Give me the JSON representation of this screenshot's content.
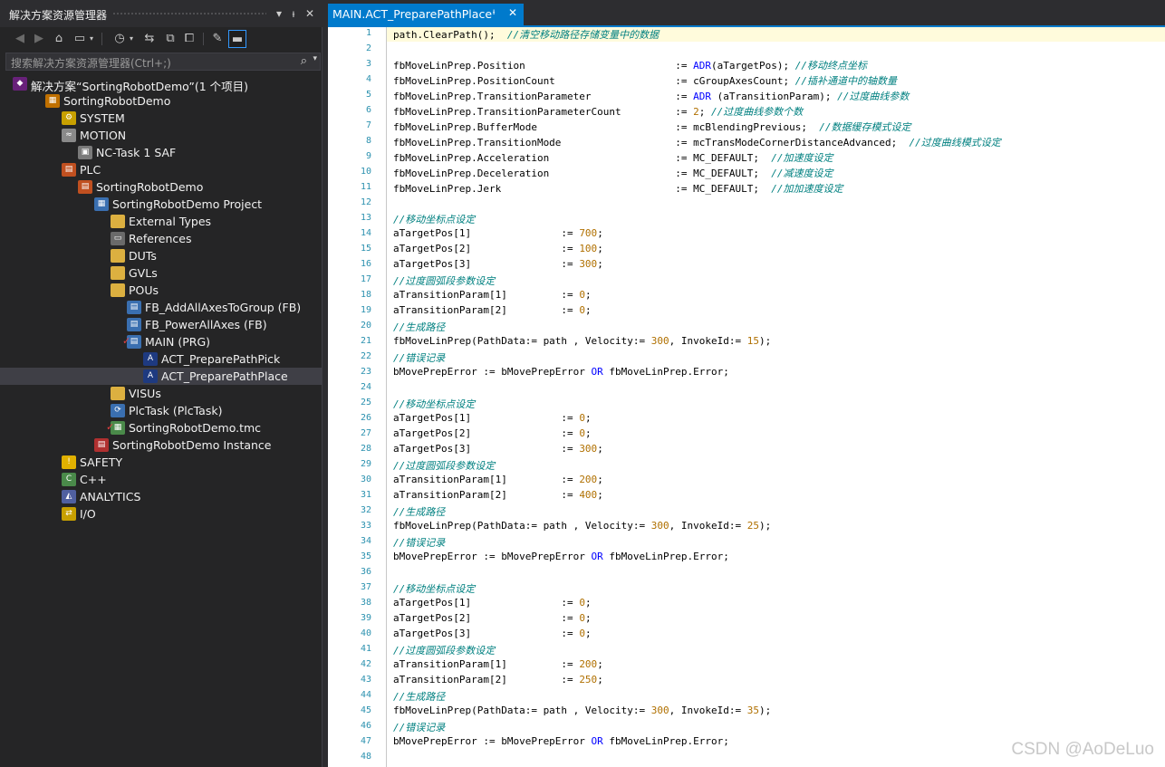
{
  "explorer": {
    "title": "解决方案资源管理器",
    "search_placeholder": "搜索解决方案资源管理器(Ctrl+;)",
    "pin_glyph": "ᵼ",
    "close_glyph": "✕",
    "dropdown_glyph": "▾"
  },
  "tree": [
    {
      "label": "解决方案“SortingRobotDemo”(1 个项目)",
      "depth": 0,
      "arrow": "",
      "icon": "solution-icon",
      "color": "#68217a",
      "glyph": "◆",
      "check": false
    },
    {
      "label": "SortingRobotDemo",
      "depth": 1,
      "arrow": "◢",
      "icon": "project-icon",
      "color": "#c07000",
      "glyph": "▦",
      "check": false
    },
    {
      "label": "SYSTEM",
      "depth": 2,
      "arrow": "▷",
      "icon": "system-icon",
      "color": "#c8a000",
      "glyph": "⚙",
      "check": false
    },
    {
      "label": "MOTION",
      "depth": 2,
      "arrow": "◢",
      "icon": "motion-icon",
      "color": "#8a8a8a",
      "glyph": "≈",
      "check": false
    },
    {
      "label": "NC-Task 1 SAF",
      "depth": 3,
      "arrow": "▷",
      "icon": "nc-task-icon",
      "color": "#7a7a7a",
      "glyph": "▣",
      "check": false
    },
    {
      "label": "PLC",
      "depth": 2,
      "arrow": "◢",
      "icon": "plc-icon",
      "color": "#c05020",
      "glyph": "▤",
      "check": false
    },
    {
      "label": "SortingRobotDemo",
      "depth": 3,
      "arrow": "◢",
      "icon": "plc-project-icon",
      "color": "#c05020",
      "glyph": "▤",
      "check": false
    },
    {
      "label": "SortingRobotDemo Project",
      "depth": 4,
      "arrow": "◢",
      "icon": "plc-subproject-icon",
      "color": "#3a6fb0",
      "glyph": "▦",
      "check": false
    },
    {
      "label": "External Types",
      "depth": 5,
      "arrow": "▷",
      "icon": "folder-icon",
      "color": "#dcb040",
      "glyph": "",
      "check": false
    },
    {
      "label": "References",
      "depth": 5,
      "arrow": "▷",
      "icon": "references-icon",
      "color": "#6a6a6a",
      "glyph": "▭",
      "check": false
    },
    {
      "label": "DUTs",
      "depth": 5,
      "arrow": "",
      "icon": "folder-icon",
      "color": "#dcb040",
      "glyph": "",
      "check": false
    },
    {
      "label": "GVLs",
      "depth": 5,
      "arrow": "▷",
      "icon": "folder-icon",
      "color": "#dcb040",
      "glyph": "",
      "check": false
    },
    {
      "label": "POUs",
      "depth": 5,
      "arrow": "◢",
      "icon": "folder-open-icon",
      "color": "#dcb040",
      "glyph": "",
      "check": false
    },
    {
      "label": "FB_AddAllAxesToGroup (FB)",
      "depth": 6,
      "arrow": "",
      "icon": "function-block-icon",
      "color": "#3a6fb0",
      "glyph": "▤",
      "check": false
    },
    {
      "label": "FB_PowerAllAxes (FB)",
      "depth": 6,
      "arrow": "",
      "icon": "function-block-icon",
      "color": "#3a6fb0",
      "glyph": "▤",
      "check": false
    },
    {
      "label": "MAIN (PRG)",
      "depth": 6,
      "arrow": "◢",
      "icon": "program-icon",
      "color": "#3a6fb0",
      "glyph": "▤",
      "check": true
    },
    {
      "label": "ACT_PreparePathPick",
      "depth": 7,
      "arrow": "",
      "icon": "action-icon",
      "color": "#1e3a80",
      "glyph": "A",
      "check": false
    },
    {
      "label": "ACT_PreparePathPlace",
      "depth": 7,
      "arrow": "",
      "icon": "action-icon",
      "color": "#1e3a80",
      "glyph": "A",
      "check": false,
      "selected": true
    },
    {
      "label": "VISUs",
      "depth": 5,
      "arrow": "",
      "icon": "folder-icon",
      "color": "#dcb040",
      "glyph": "",
      "check": false
    },
    {
      "label": "PlcTask (PlcTask)",
      "depth": 5,
      "arrow": "▷",
      "icon": "task-icon",
      "color": "#3a6fb0",
      "glyph": "⟳",
      "check": false
    },
    {
      "label": "SortingRobotDemo.tmc",
      "depth": 5,
      "arrow": "",
      "icon": "tmc-file-icon",
      "color": "#4a8a4a",
      "glyph": "▦",
      "check": true
    },
    {
      "label": "SortingRobotDemo Instance",
      "depth": 4,
      "arrow": "▷",
      "icon": "instance-icon",
      "color": "#b03030",
      "glyph": "▤",
      "check": false
    },
    {
      "label": "SAFETY",
      "depth": 2,
      "arrow": "",
      "icon": "safety-icon",
      "color": "#e0b000",
      "glyph": "!",
      "check": false
    },
    {
      "label": "C++",
      "depth": 2,
      "arrow": "",
      "icon": "cpp-icon",
      "color": "#4a8a4a",
      "glyph": "C",
      "check": false
    },
    {
      "label": "ANALYTICS",
      "depth": 2,
      "arrow": "",
      "icon": "analytics-icon",
      "color": "#5060a0",
      "glyph": "◭",
      "check": false
    },
    {
      "label": "I/O",
      "depth": 2,
      "arrow": "▷",
      "icon": "io-icon",
      "color": "#c8a000",
      "glyph": "⇄",
      "check": false
    }
  ],
  "editor": {
    "tab_label": "MAIN.ACT_PreparePathPlace",
    "tab_pin": "ᵼ",
    "tab_close": "✕"
  },
  "code_lines": [
    {
      "n": "1",
      "parts": [
        [
          "t",
          "path.ClearPath();  "
        ],
        [
          "c",
          "//清空移动路径存储变量中的数据"
        ]
      ]
    },
    {
      "n": "2",
      "parts": []
    },
    {
      "n": "3",
      "parts": [
        [
          "t",
          "fbMoveLinPrep.Position                         := "
        ],
        [
          "k",
          "ADR"
        ],
        [
          "t",
          "(aTargetPos); "
        ],
        [
          "c",
          "//移动终点坐标"
        ]
      ]
    },
    {
      "n": "4",
      "parts": [
        [
          "t",
          "fbMoveLinPrep.PositionCount                    := cGroupAxesCount; "
        ],
        [
          "c",
          "//插补通道中的轴数量"
        ]
      ]
    },
    {
      "n": "5",
      "parts": [
        [
          "t",
          "fbMoveLinPrep.TransitionParameter              := "
        ],
        [
          "k",
          "ADR"
        ],
        [
          "t",
          " (aTransitionParam); "
        ],
        [
          "c",
          "//过度曲线参数"
        ]
      ]
    },
    {
      "n": "6",
      "parts": [
        [
          "t",
          "fbMoveLinPrep.TransitionParameterCount         := "
        ],
        [
          "n",
          "2"
        ],
        [
          "t",
          "; "
        ],
        [
          "c",
          "//过度曲线参数个数"
        ]
      ]
    },
    {
      "n": "7",
      "parts": [
        [
          "t",
          "fbMoveLinPrep.BufferMode                       := mcBlendingPrevious;  "
        ],
        [
          "c",
          "//数据缓存模式设定"
        ]
      ]
    },
    {
      "n": "8",
      "parts": [
        [
          "t",
          "fbMoveLinPrep.TransitionMode                   := mcTransModeCornerDistanceAdvanced;  "
        ],
        [
          "c",
          "//过度曲线模式设定"
        ]
      ]
    },
    {
      "n": "9",
      "parts": [
        [
          "t",
          "fbMoveLinPrep.Acceleration                     := MC_DEFAULT;  "
        ],
        [
          "c",
          "//加速度设定"
        ]
      ]
    },
    {
      "n": "10",
      "parts": [
        [
          "t",
          "fbMoveLinPrep.Deceleration                     := MC_DEFAULT;  "
        ],
        [
          "c",
          "//减速度设定"
        ]
      ]
    },
    {
      "n": "11",
      "parts": [
        [
          "t",
          "fbMoveLinPrep.Jerk                             := MC_DEFAULT;  "
        ],
        [
          "c",
          "//加加速度设定"
        ]
      ]
    },
    {
      "n": "12",
      "parts": []
    },
    {
      "n": "13",
      "parts": [
        [
          "c",
          "//移动坐标点设定"
        ]
      ]
    },
    {
      "n": "14",
      "parts": [
        [
          "t",
          "aTargetPos[1]               := "
        ],
        [
          "n",
          "700"
        ],
        [
          "t",
          ";"
        ]
      ]
    },
    {
      "n": "15",
      "parts": [
        [
          "t",
          "aTargetPos[2]               := "
        ],
        [
          "n",
          "100"
        ],
        [
          "t",
          ";"
        ]
      ]
    },
    {
      "n": "16",
      "parts": [
        [
          "t",
          "aTargetPos[3]               := "
        ],
        [
          "n",
          "300"
        ],
        [
          "t",
          ";"
        ]
      ]
    },
    {
      "n": "17",
      "parts": [
        [
          "c",
          "//过度圆弧段参数设定"
        ]
      ]
    },
    {
      "n": "18",
      "parts": [
        [
          "t",
          "aTransitionParam[1]         := "
        ],
        [
          "n",
          "0"
        ],
        [
          "t",
          ";"
        ]
      ]
    },
    {
      "n": "19",
      "parts": [
        [
          "t",
          "aTransitionParam[2]         := "
        ],
        [
          "n",
          "0"
        ],
        [
          "t",
          ";"
        ]
      ]
    },
    {
      "n": "20",
      "parts": [
        [
          "c",
          "//生成路径"
        ]
      ]
    },
    {
      "n": "21",
      "parts": [
        [
          "t",
          "fbMoveLinPrep(PathData:= path , Velocity:= "
        ],
        [
          "n",
          "300"
        ],
        [
          "t",
          ", InvokeId:= "
        ],
        [
          "n",
          "15"
        ],
        [
          "t",
          ");"
        ]
      ]
    },
    {
      "n": "22",
      "parts": [
        [
          "c",
          "//错误记录"
        ]
      ]
    },
    {
      "n": "23",
      "parts": [
        [
          "t",
          "bMovePrepError := bMovePrepError "
        ],
        [
          "k",
          "OR"
        ],
        [
          "t",
          " fbMoveLinPrep.Error;"
        ]
      ]
    },
    {
      "n": "24",
      "parts": []
    },
    {
      "n": "25",
      "parts": [
        [
          "c",
          "//移动坐标点设定"
        ]
      ]
    },
    {
      "n": "26",
      "parts": [
        [
          "t",
          "aTargetPos[1]               := "
        ],
        [
          "n",
          "0"
        ],
        [
          "t",
          ";"
        ]
      ]
    },
    {
      "n": "27",
      "parts": [
        [
          "t",
          "aTargetPos[2]               := "
        ],
        [
          "n",
          "0"
        ],
        [
          "t",
          ";"
        ]
      ]
    },
    {
      "n": "28",
      "parts": [
        [
          "t",
          "aTargetPos[3]               := "
        ],
        [
          "n",
          "300"
        ],
        [
          "t",
          ";"
        ]
      ]
    },
    {
      "n": "29",
      "parts": [
        [
          "c",
          "//过度圆弧段参数设定"
        ]
      ]
    },
    {
      "n": "30",
      "parts": [
        [
          "t",
          "aTransitionParam[1]         := "
        ],
        [
          "n",
          "200"
        ],
        [
          "t",
          ";"
        ]
      ]
    },
    {
      "n": "31",
      "parts": [
        [
          "t",
          "aTransitionParam[2]         := "
        ],
        [
          "n",
          "400"
        ],
        [
          "t",
          ";"
        ]
      ]
    },
    {
      "n": "32",
      "parts": [
        [
          "c",
          "//生成路径"
        ]
      ]
    },
    {
      "n": "33",
      "parts": [
        [
          "t",
          "fbMoveLinPrep(PathData:= path , Velocity:= "
        ],
        [
          "n",
          "300"
        ],
        [
          "t",
          ", InvokeId:= "
        ],
        [
          "n",
          "25"
        ],
        [
          "t",
          ");"
        ]
      ]
    },
    {
      "n": "34",
      "parts": [
        [
          "c",
          "//错误记录"
        ]
      ]
    },
    {
      "n": "35",
      "parts": [
        [
          "t",
          "bMovePrepError := bMovePrepError "
        ],
        [
          "k",
          "OR"
        ],
        [
          "t",
          " fbMoveLinPrep.Error;"
        ]
      ]
    },
    {
      "n": "36",
      "parts": []
    },
    {
      "n": "37",
      "parts": [
        [
          "c",
          "//移动坐标点设定"
        ]
      ]
    },
    {
      "n": "38",
      "parts": [
        [
          "t",
          "aTargetPos[1]               := "
        ],
        [
          "n",
          "0"
        ],
        [
          "t",
          ";"
        ]
      ]
    },
    {
      "n": "39",
      "parts": [
        [
          "t",
          "aTargetPos[2]               := "
        ],
        [
          "n",
          "0"
        ],
        [
          "t",
          ";"
        ]
      ]
    },
    {
      "n": "40",
      "parts": [
        [
          "t",
          "aTargetPos[3]               := "
        ],
        [
          "n",
          "0"
        ],
        [
          "t",
          ";"
        ]
      ]
    },
    {
      "n": "41",
      "parts": [
        [
          "c",
          "//过度圆弧段参数设定"
        ]
      ]
    },
    {
      "n": "42",
      "parts": [
        [
          "t",
          "aTransitionParam[1]         := "
        ],
        [
          "n",
          "200"
        ],
        [
          "t",
          ";"
        ]
      ]
    },
    {
      "n": "43",
      "parts": [
        [
          "t",
          "aTransitionParam[2]         := "
        ],
        [
          "n",
          "250"
        ],
        [
          "t",
          ";"
        ]
      ]
    },
    {
      "n": "44",
      "parts": [
        [
          "c",
          "//生成路径"
        ]
      ]
    },
    {
      "n": "45",
      "parts": [
        [
          "t",
          "fbMoveLinPrep(PathData:= path , Velocity:= "
        ],
        [
          "n",
          "300"
        ],
        [
          "t",
          ", InvokeId:= "
        ],
        [
          "n",
          "35"
        ],
        [
          "t",
          ");"
        ]
      ]
    },
    {
      "n": "46",
      "parts": [
        [
          "c",
          "//错误记录"
        ]
      ]
    },
    {
      "n": "47",
      "parts": [
        [
          "t",
          "bMovePrepError := bMovePrepError "
        ],
        [
          "k",
          "OR"
        ],
        [
          "t",
          " fbMoveLinPrep.Error;"
        ]
      ]
    },
    {
      "n": "48",
      "parts": []
    }
  ],
  "watermark": "CSDN @AoDeLuo"
}
